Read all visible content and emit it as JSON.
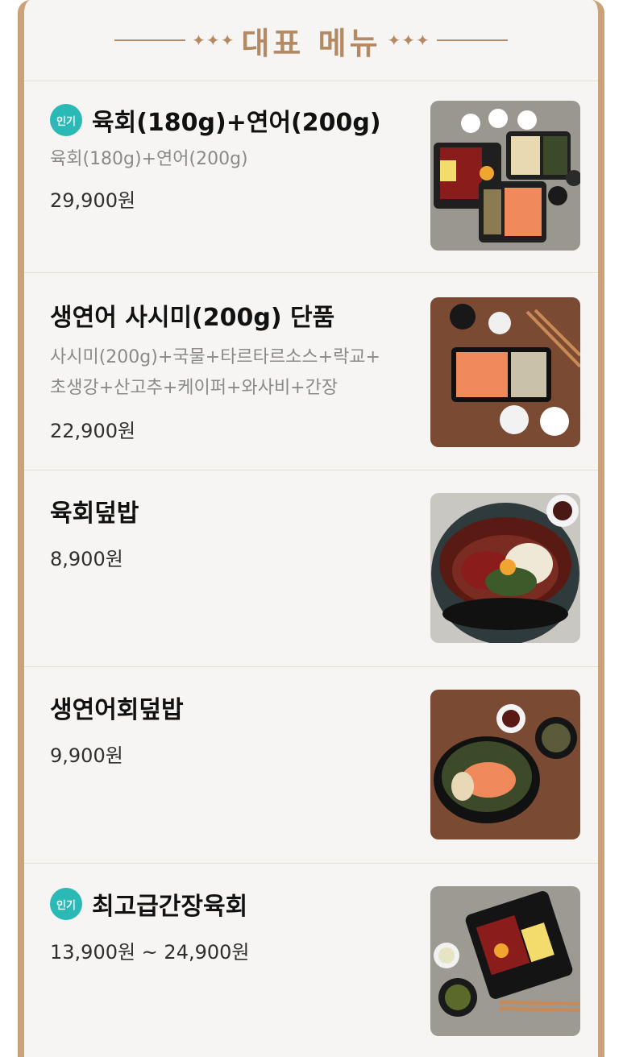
{
  "header": {
    "title": "대표 메뉴",
    "left_decoration": "✦✦✦",
    "right_decoration": "✦✦✦"
  },
  "menu": {
    "items": [
      {
        "badge": "인기",
        "name": "육회(180g)+연어(200g)",
        "desc_lines": [
          "육회(180g)+연어(200g)"
        ],
        "price": "29,900원",
        "image_icon": "yukhoe-salmon-image"
      },
      {
        "badge": "",
        "name": "생연어 사시미(200g) 단품",
        "desc_lines": [
          "사시미(200g)+국물+타르타르소스+락교+",
          "초생강+산고추+케이퍼+와사비+간장"
        ],
        "price": "22,900원",
        "image_icon": "salmon-sashimi-image"
      },
      {
        "badge": "",
        "name": "육회덮밥",
        "desc_lines": [],
        "price": "8,900원",
        "image_icon": "yukhoe-rice-bowl-image"
      },
      {
        "badge": "",
        "name": "생연어회덮밥",
        "desc_lines": [],
        "price": "9,900원",
        "image_icon": "salmon-rice-bowl-image"
      },
      {
        "badge": "인기",
        "name": "최고급간장육회",
        "desc_lines": [],
        "price": "13,900원 ~ 24,900원",
        "image_icon": "soy-yukhoe-image"
      }
    ]
  },
  "colors": {
    "accent_gold": "#b38a63",
    "badge_teal": "#2bb9b6",
    "panel_bg": "#f6f5f3"
  }
}
